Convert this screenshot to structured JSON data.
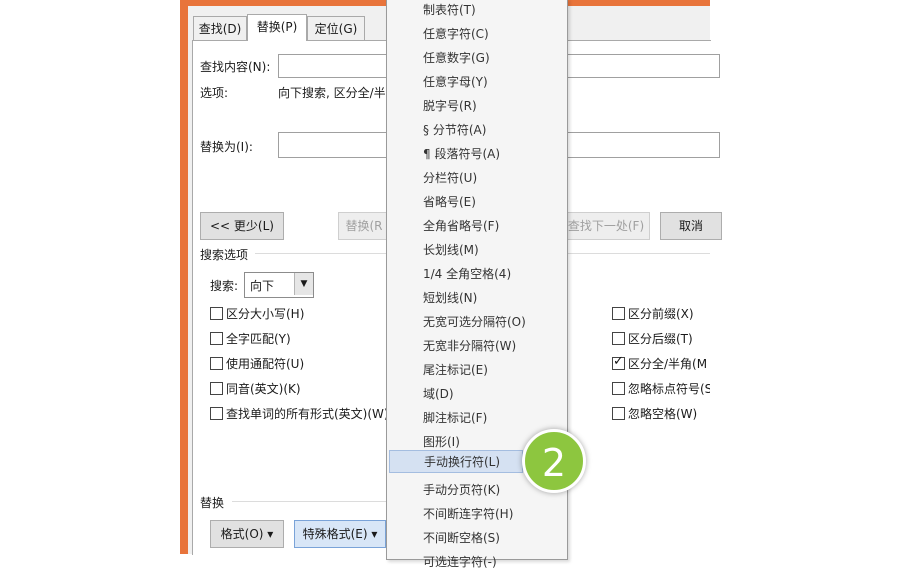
{
  "tabs": [
    {
      "label": "查找(D)"
    },
    {
      "label": "替换(P)"
    },
    {
      "label": "定位(G)"
    }
  ],
  "find": {
    "label": "查找内容(N):",
    "value": ""
  },
  "options": {
    "label": "选项:",
    "value": "向下搜索, 区分全/半"
  },
  "replace": {
    "label": "替换为(I):",
    "value": ""
  },
  "buttons": {
    "less": "<< 更少(L)",
    "replace": "替换(R",
    "find_next": "查找下一处(F)",
    "cancel": "取消"
  },
  "search_options": {
    "title": "搜索选项",
    "search_label": "搜索:",
    "search_value": "向下",
    "left_checkboxes": [
      {
        "label": "区分大小写(H)",
        "checked": false
      },
      {
        "label": "全字匹配(Y)",
        "checked": false
      },
      {
        "label": "使用通配符(U)",
        "checked": false
      },
      {
        "label": "同音(英文)(K)",
        "checked": false
      },
      {
        "label": "查找单词的所有形式(英文)(W)",
        "checked": false
      }
    ],
    "right_checkboxes": [
      {
        "label": "区分前缀(X)",
        "checked": false
      },
      {
        "label": "区分后缀(T)",
        "checked": false
      },
      {
        "label": "区分全/半角(M",
        "checked": true
      },
      {
        "label": "忽略标点符号(S",
        "checked": false
      },
      {
        "label": "忽略空格(W)",
        "checked": false
      }
    ]
  },
  "replace_section": {
    "title": "替换",
    "format_button": "格式(O) ▾",
    "special_button": "特殊格式(E) ▾"
  },
  "special_menu": {
    "items": [
      "制表符(T)",
      "任意字符(C)",
      "任意数字(G)",
      "任意字母(Y)",
      "脱字号(R)",
      "§ 分节符(A)",
      "¶ 段落符号(A)",
      "分栏符(U)",
      "省略号(E)",
      "全角省略号(F)",
      "长划线(M)",
      "1/4 全角空格(4)",
      "短划线(N)",
      "无宽可选分隔符(O)",
      "无宽非分隔符(W)",
      "尾注标记(E)",
      "域(D)",
      "脚注标记(F)",
      "图形(I)",
      "手动换行符(L)",
      "手动分页符(K)",
      "不间断连字符(H)",
      "不间断空格(S)",
      "可选连字符(-)"
    ],
    "highlighted_index": 19
  },
  "step_badge": "2",
  "colors": {
    "frame": "#e8743b",
    "badge": "#8dc63f",
    "highlight": "#d5e1f2"
  }
}
